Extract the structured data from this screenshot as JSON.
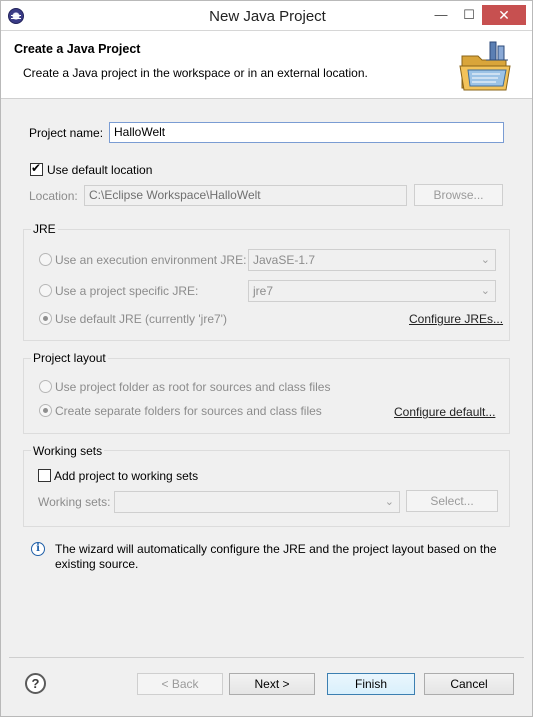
{
  "window": {
    "title": "New Java Project",
    "minimize": "—",
    "maximize": "☐",
    "close": "✕"
  },
  "banner": {
    "title": "Create a Java Project",
    "description": "Create a Java project in the workspace or in an external location."
  },
  "project": {
    "name_label": "Project name:",
    "name_value": "HalloWelt",
    "use_default_location_label": "Use default location",
    "location_label": "Location:",
    "location_value": "C:\\Eclipse Workspace\\HalloWelt",
    "browse_label": "Browse..."
  },
  "jre": {
    "group_title": "JRE",
    "exec_env_label": "Use an execution environment JRE:",
    "exec_env_value": "JavaSE-1.7",
    "project_specific_label": "Use a project specific JRE:",
    "project_specific_value": "jre7",
    "default_label": "Use default JRE (currently 'jre7')",
    "configure_link": "Configure JREs..."
  },
  "layout": {
    "group_title": "Project layout",
    "root_label": "Use project folder as root for sources and class files",
    "separate_label": "Create separate folders for sources and class files",
    "configure_link": "Configure default..."
  },
  "working_sets": {
    "group_title": "Working sets",
    "add_label": "Add project to working sets",
    "sets_label": "Working sets:",
    "select_label": "Select..."
  },
  "info": {
    "message": "The wizard will automatically configure the JRE and the project layout based on the existing source."
  },
  "footer": {
    "help_label": "?",
    "back_label": "< Back",
    "next_label": "Next >",
    "finish_label": "Finish",
    "cancel_label": "Cancel"
  },
  "icons": {
    "window": "eclipse-icon",
    "banner": "new-java-project-folder-icon",
    "info": "info-icon",
    "help": "help-icon"
  }
}
